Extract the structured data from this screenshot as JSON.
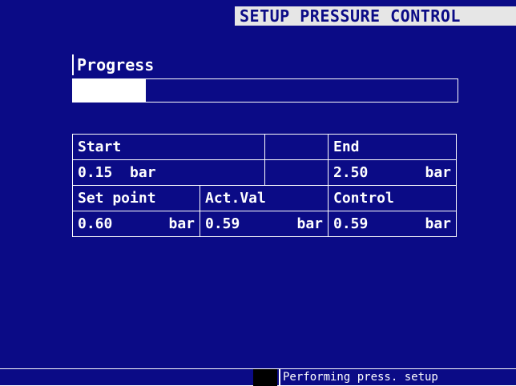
{
  "header": {
    "title": "SETUP PRESSURE CONTROL"
  },
  "progress": {
    "label": "Progress",
    "fraction": 0.19
  },
  "table": {
    "start_label": "Start",
    "end_label": "End",
    "start_value": "0.15",
    "start_unit": "bar",
    "end_value": "2.50",
    "end_unit": "bar",
    "setpoint_label": "Set point",
    "actval_label": "Act.Val",
    "control_label": "Control",
    "setpoint_value": "0.60",
    "setpoint_unit": "bar",
    "actval_value": "0.59",
    "actval_unit": "bar",
    "control_value": "0.59",
    "control_unit": "bar"
  },
  "status": {
    "text": "Performing press. setup"
  },
  "colors": {
    "background": "#0b0b86",
    "title_bg": "#e6e6e6",
    "foreground": "#ffffff",
    "status_block": "#000000"
  }
}
